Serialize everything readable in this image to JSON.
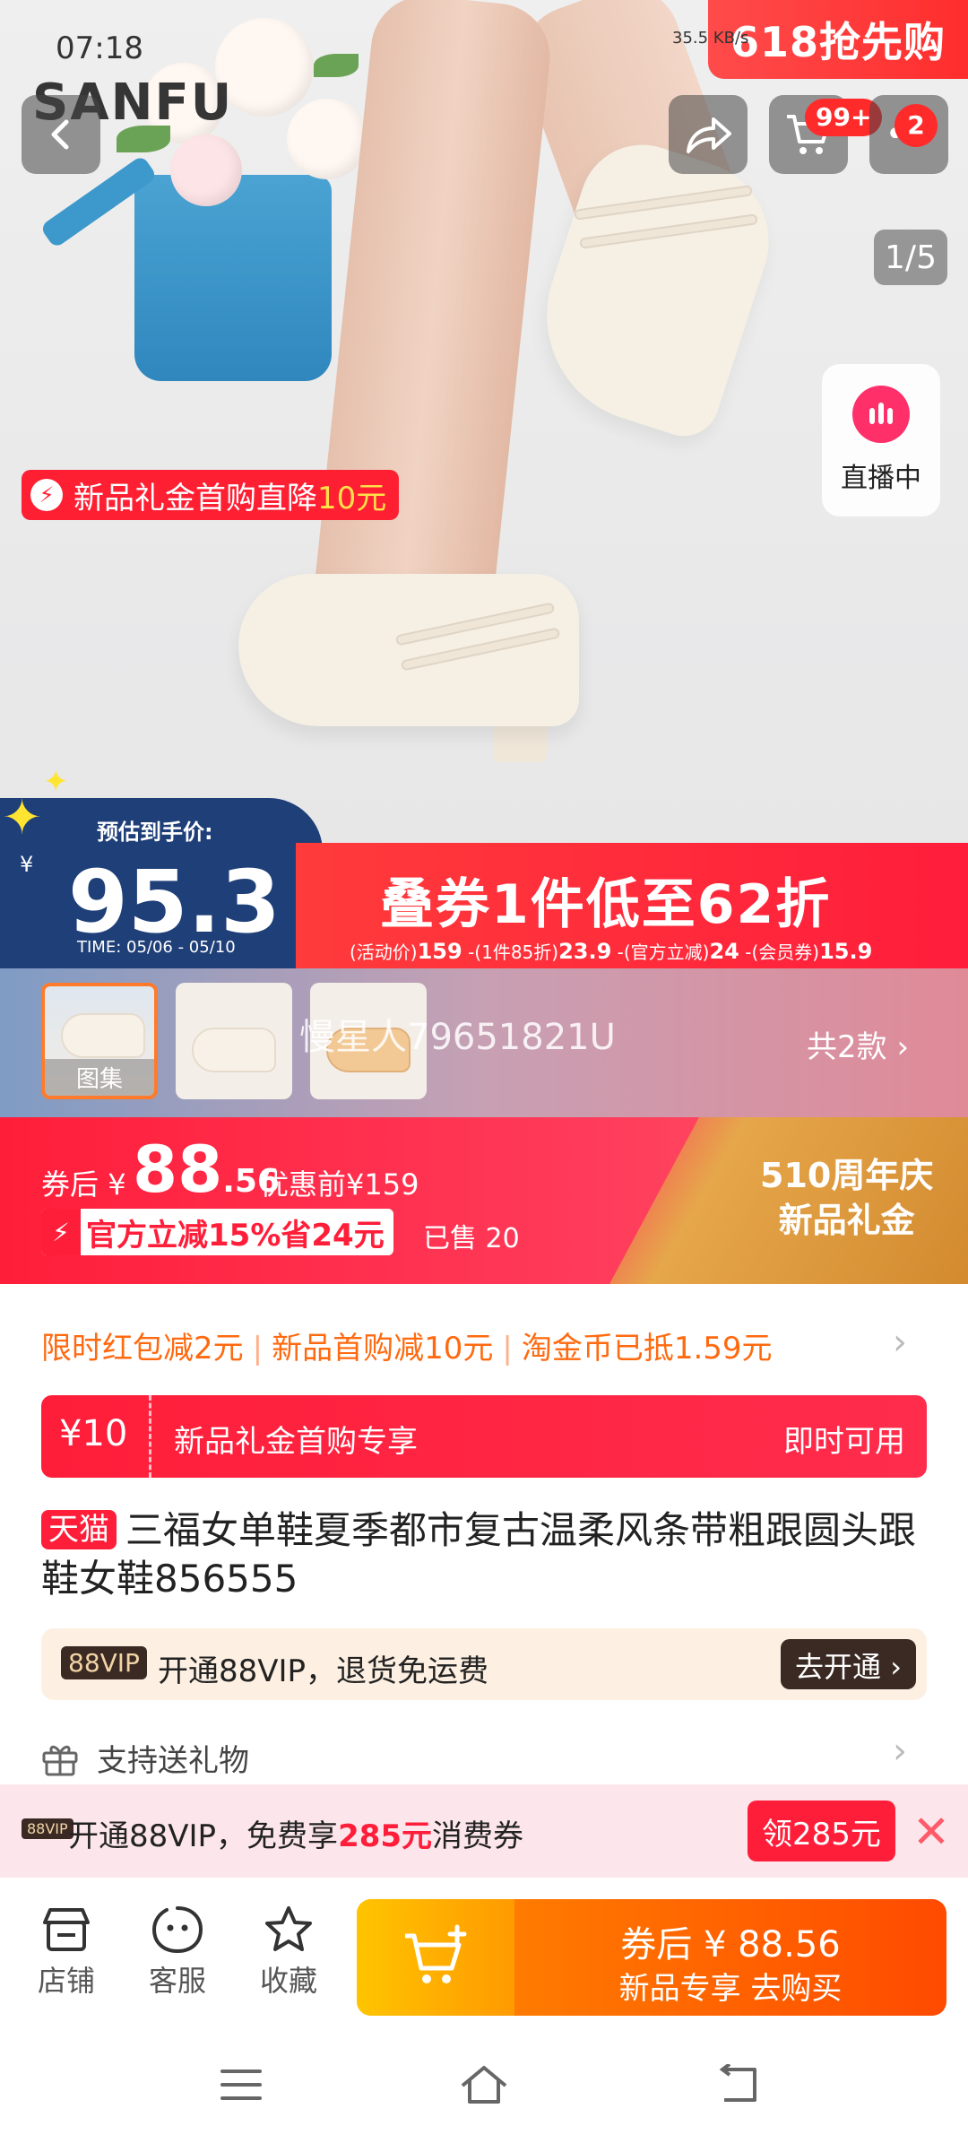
{
  "status": {
    "time": "07:18",
    "net_speed": "35.5 KB/s",
    "net_icons": "HD 4G 5G"
  },
  "brand": {
    "logo_text": "SANFU"
  },
  "hero": {
    "campaign_badge": "618抢先购",
    "page_counter": "1/5",
    "live_label": "直播中",
    "promo_tag_prefix": "新品礼金首购直降",
    "promo_tag_amount": "10元"
  },
  "price_banner": {
    "estimate_label": "预估到手价:",
    "yen": "¥",
    "estimate_price": "95.3",
    "time_range": "TIME: 05/06 - 05/10",
    "headline": "叠券1件低至62折",
    "breakdown": [
      "(活动价)",
      "159",
      "-(1件85折)",
      "23.9",
      "-(官方立减)",
      "24",
      "-(会员券)",
      "15.9"
    ]
  },
  "gallery": {
    "thumbs": [
      {
        "label": "图集"
      },
      {
        "label": ""
      },
      {
        "label": ""
      }
    ],
    "watermark": "慢星人79651821U",
    "variant_count": "共2款"
  },
  "price_info": {
    "after_coupon_label": "券后",
    "yen": "¥",
    "price_int": "88",
    "price_dec": ".56",
    "before_label": "优惠前¥159",
    "official_cut": "官方立减15%省24元",
    "sold": "已售 20",
    "anniversary_line1": "510周年庆",
    "anniversary_line2": "新品礼金"
  },
  "promotions": [
    "限时红包减2元",
    "新品首购减10元",
    "淘金币已抵1.59元"
  ],
  "coupon": {
    "amount": "¥10",
    "desc": "新品礼金首购专享",
    "action": "即时可用"
  },
  "product": {
    "store_tag": "天猫",
    "title": "三福女单鞋夏季都市复古温柔风条带粗跟圆头跟鞋女鞋856555"
  },
  "vip": {
    "badge": "88VIP",
    "text": "开通88VIP，退货免运费",
    "button": "去开通 ›"
  },
  "gift": {
    "label": "支持送礼物"
  },
  "vip_promo": {
    "badge": "88VIP",
    "text_prefix": "开通88VIP，免费享",
    "amount": "285元",
    "text_suffix": "消费券",
    "button": "领285元"
  },
  "actions": {
    "store": "店铺",
    "service": "客服",
    "favorite": "收藏",
    "buy_main": "券后 ¥ 88.56",
    "buy_sub": "新品专享  去购买"
  },
  "cart_badge": "99+",
  "more_badge": "2",
  "colors": {
    "accent_red": "#ff1e3a",
    "accent_orange": "#ff6a10",
    "banner_blue": "#1f3f78"
  }
}
